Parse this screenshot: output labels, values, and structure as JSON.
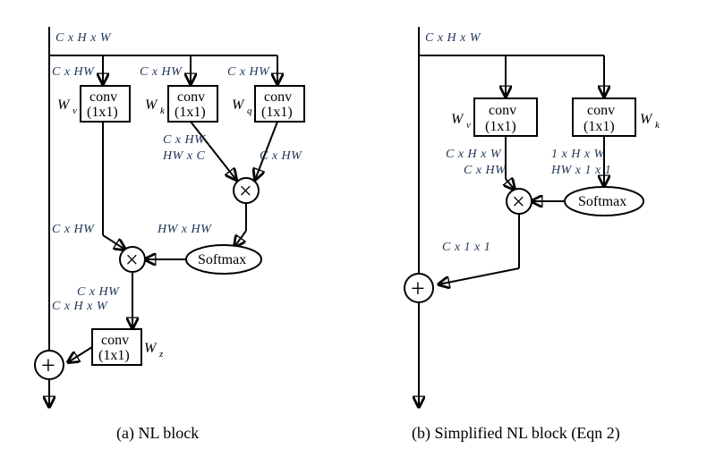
{
  "diagram": {
    "left": {
      "name": "NL block",
      "input_shape": "C x H x W",
      "reshape": "C x HW",
      "branches": {
        "v": {
          "weight": "W",
          "weight_sub": "v",
          "op": "conv",
          "kernel": "(1x1)"
        },
        "k": {
          "weight": "W",
          "weight_sub": "k",
          "op": "conv",
          "kernel": "(1x1)"
        },
        "q": {
          "weight": "W",
          "weight_sub": "q",
          "op": "conv",
          "kernel": "(1x1)"
        },
        "z": {
          "weight": "W",
          "weight_sub": "z",
          "op": "conv",
          "kernel": "(1x1)"
        }
      },
      "dims": {
        "kq_in": "C x HW",
        "kq_transpose": "HW x C",
        "attn": "HW x HW",
        "v_out": "C x HW",
        "z_in_shape": "C x H x W"
      },
      "softmax_label": "Softmax",
      "caption": "(a) NL block"
    },
    "right": {
      "name": "Simplified NL block",
      "input_shape": "C x H x W",
      "branches": {
        "v": {
          "weight": "W",
          "weight_sub": "v",
          "op": "conv",
          "kernel": "(1x1)",
          "out_shape": "C x H x W",
          "reshape": "C x HW"
        },
        "k": {
          "weight": "W",
          "weight_sub": "k",
          "op": "conv",
          "kernel": "(1x1)",
          "out_shape": "1 x H x W",
          "reshape": "HW x 1 x 1"
        }
      },
      "softmax_label": "Softmax",
      "mul_out_shape": "C x 1 x 1",
      "caption": "(b) Simplified NL block (Eqn 2)"
    }
  }
}
